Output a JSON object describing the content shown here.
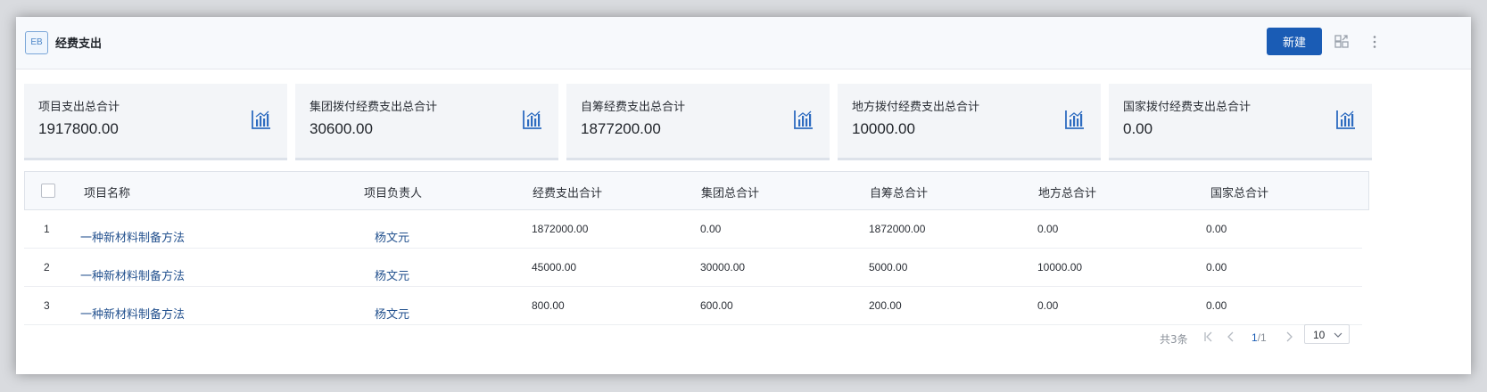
{
  "header": {
    "badge": "EB",
    "title": "经费支出",
    "new_label": "新建",
    "icons": [
      "layout-icon",
      "more-vertical-icon"
    ]
  },
  "summaries": [
    {
      "label": "项目支出总合计",
      "value": "1917800.00",
      "icon": "bar-chart-icon"
    },
    {
      "label": "集团拨付经费支出总合计",
      "value": "30600.00",
      "icon": "bar-chart-icon"
    },
    {
      "label": "自筹经费支出总合计",
      "value": "1877200.00",
      "icon": "bar-chart-icon"
    },
    {
      "label": "地方拨付经费支出总合计",
      "value": "10000.00",
      "icon": "bar-chart-icon"
    },
    {
      "label": "国家拨付经费支出总合计",
      "value": "0.00",
      "icon": "bar-chart-icon"
    }
  ],
  "table": {
    "columns": [
      "项目名称",
      "项目负责人",
      "经费支出合计",
      "集团总合计",
      "自筹总合计",
      "地方总合计",
      "国家总合计"
    ],
    "rows": [
      {
        "index": "1",
        "name": "一种新材料制备方法",
        "owner": "杨文元",
        "total": "1872000.00",
        "group": "0.00",
        "self": "1872000.00",
        "local": "0.00",
        "national": "0.00"
      },
      {
        "index": "2",
        "name": "一种新材料制备方法",
        "owner": "杨文元",
        "total": "45000.00",
        "group": "30000.00",
        "self": "5000.00",
        "local": "10000.00",
        "national": "0.00"
      },
      {
        "index": "3",
        "name": "一种新材料制备方法",
        "owner": "杨文元",
        "total": "800.00",
        "group": "600.00",
        "self": "200.00",
        "local": "0.00",
        "national": "0.00"
      }
    ]
  },
  "pager": {
    "total_text": "共3条",
    "current_page": "1",
    "page_sep": "/1",
    "page_size": "10"
  },
  "colors": {
    "primary": "#1a5cb5",
    "link": "#24528f"
  }
}
